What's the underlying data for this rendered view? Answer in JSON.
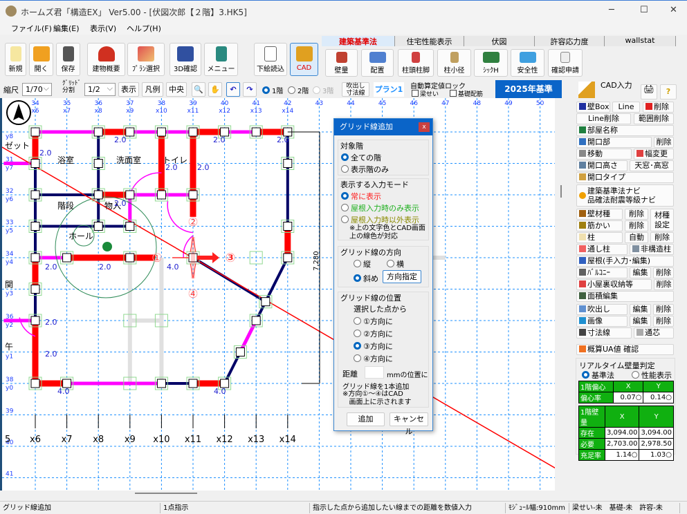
{
  "window": {
    "title": "ホームズ君「構造EX」 Ver5.00 - [伏図次郎【２階】3.HK5]",
    "minimize": "─",
    "maximize": "☐",
    "close": "✕"
  },
  "menu": [
    "ファイル(F)",
    "編集(E)",
    "表示(V)",
    "ヘルプ(H)"
  ],
  "toolbar": [
    {
      "label": "新規",
      "icon": "new-file-star-icon"
    },
    {
      "label": "開く",
      "icon": "open-folder-icon"
    },
    {
      "label": "保存",
      "icon": "save-floppy-icon"
    },
    {
      "label": "建物概要",
      "icon": "house-icon"
    },
    {
      "label": "ﾌﾟﾗﾝ選択",
      "icon": "plan-select-icon"
    },
    {
      "label": "3D確認",
      "icon": "3d-house-icon"
    },
    {
      "label": "メニュー",
      "icon": "exit-door-icon"
    },
    {
      "label": "下絵読込",
      "icon": "jpg-import-icon"
    },
    {
      "label": "CAD",
      "icon": "cad-triangle-icon",
      "active": true
    }
  ],
  "tabs": [
    {
      "label": "建築基準法",
      "active": true
    },
    {
      "label": "住宅性能表示"
    },
    {
      "label": "伏図"
    },
    {
      "label": "許容応力度"
    },
    {
      "label": "wallstat"
    }
  ],
  "tab_buttons": [
    "壁量",
    "配置",
    "柱頭柱脚",
    "柱小径",
    "ｼｯｸH",
    "安全性",
    "確認申請"
  ],
  "toolbar2": {
    "scale_label": "縮尺",
    "scale_value": "1/70",
    "grid_label_1": "ｸﾞﾘｯﾄﾞ",
    "grid_label_2": "分割",
    "grid_value": "1/2",
    "show": "表示",
    "legend": "凡例",
    "center": "中央",
    "floors": [
      {
        "label": "1階",
        "selected": true
      },
      {
        "label": "2階"
      },
      {
        "label": "3階",
        "disabled": true
      }
    ],
    "balloon_dim_1": "吹出し",
    "balloon_dim_2": "寸法線",
    "plan": "プラン1",
    "auto_lock": "自動算定値ロック",
    "beam": "梁せい",
    "foundation": "基礎配筋",
    "standard": "2025年基準"
  },
  "right_panel": {
    "cad_input": "CAD入力",
    "help": "?",
    "wall_box": "壁Box",
    "line": "Line",
    "delete": "削除",
    "line_delete": "Line削除",
    "range_delete": "範囲削除",
    "room_name": "部屋名称",
    "opening": "開口部",
    "move": "移動",
    "width_change": "幅変更",
    "opening_height": "開口高さ",
    "skylight": "天窓･高窓",
    "opening_type": "開口タイプ",
    "navi_1": "建築基準法ナビ",
    "navi_2": "品確法耐震等級ナビ",
    "wall_material": "壁材種",
    "brace": "筋かい",
    "material_setting_1": "材種",
    "material_setting_2": "設定",
    "column": "柱",
    "auto": "自動",
    "through_column": "通し柱",
    "nonstructural_column": "非構造柱",
    "roof": "屋根(手入力･編集)",
    "balcony": "ﾊﾞﾙｺﾆｰ",
    "edit": "編集",
    "attic": "小屋裏収納等",
    "area_edit": "面積編集",
    "balloon": "吹出し",
    "image": "画像",
    "dimension": "寸法線",
    "center_line": "通芯",
    "ua": "概算UA値 確認",
    "realtime": {
      "title": "リアルタイム壁量判定",
      "mode_standard": "基準法",
      "mode_performance": "性能表示",
      "selected": "基準法",
      "ecc_header": "1階偏心",
      "x": "X",
      "y": "Y",
      "ecc_label": "偏心率",
      "ecc_x": "0.07○",
      "ecc_y": "0.14○",
      "wall_header": "1階壁量",
      "rows": [
        {
          "label": "存在",
          "x": "3,094.00",
          "y": "3,094.00"
        },
        {
          "label": "必要",
          "x": "2,703.00",
          "y": "2,978.50"
        },
        {
          "label": "充足率",
          "x": "1.14○",
          "y": "1.03○"
        }
      ]
    }
  },
  "dialog": {
    "title": "グリッド線追加",
    "close": "x",
    "target_floor": {
      "title": "対象階",
      "options": [
        "全ての階",
        "表示階のみ"
      ],
      "selected": "全ての階"
    },
    "input_mode": {
      "title": "表示する入力モード",
      "options": [
        "常に表示",
        "屋根入力時のみ表示",
        "屋根入力時以外表示"
      ],
      "colors": [
        "#ff2020",
        "#20b020",
        "#8a8a00"
      ],
      "selected": "常に表示",
      "note_1": "※上の文字色とCAD画面",
      "note_2": "上の線色が対応"
    },
    "direction": {
      "title": "グリッド線の方向",
      "options": [
        "縦",
        "横",
        "斜め"
      ],
      "selected": "斜め",
      "specify": "方向指定"
    },
    "position": {
      "title": "グリッド線の位置",
      "from": "選択した点から",
      "options": [
        "①方向に",
        "②方向に",
        "③方向に",
        "④方向に"
      ],
      "selected": "③方向に",
      "distance_label": "距離",
      "distance_value": "",
      "distance_unit": "mmの位置に",
      "add_one": "グリッド線を1本追加",
      "note_1": "※方向①～④はCAD",
      "note_2": "画面上に示されます"
    },
    "add": "追加",
    "cancel": "キャンセル"
  },
  "canvas": {
    "col_numbers": [
      "34",
      "35",
      "36",
      "37",
      "38",
      "39",
      "40",
      "41",
      "42",
      "43",
      "44",
      "45",
      "46",
      "47",
      "48",
      "49",
      "50"
    ],
    "col_labels": [
      "x6",
      "x7",
      "x8",
      "x9",
      "x10",
      "x11",
      "x12",
      "x13",
      "x14"
    ],
    "row_labels": [
      [
        "",
        "y8"
      ],
      [
        "31",
        "y7"
      ],
      [
        "32",
        "y6"
      ],
      [
        "33",
        "y5"
      ],
      [
        "34",
        "y4"
      ],
      [
        "",
        "y3"
      ],
      [
        "36",
        "y2"
      ],
      [
        "",
        "y1"
      ],
      [
        "38",
        "y0"
      ],
      [
        "39",
        ""
      ],
      [
        "40",
        ""
      ],
      [
        "41",
        ""
      ]
    ],
    "bottom_labels": [
      "5",
      "x6",
      "x7",
      "x8",
      "x9",
      "x10",
      "x11",
      "x12",
      "x13",
      "x14"
    ],
    "rooms": [
      "浴室",
      "洗面室",
      "トイレ",
      "階段",
      "物入",
      "ホール",
      "ゼット",
      "関",
      "午"
    ],
    "wall_values": [
      "2.0",
      "2.0",
      "2.0",
      "2.0",
      "2.0",
      "2.0",
      "2.0",
      "2.0",
      "2.0",
      "4.0",
      "2.0",
      "2.0",
      "4.0",
      "4.0"
    ],
    "dimension": "7,280",
    "markers": [
      "①",
      "②",
      "③",
      "④"
    ],
    "colors": {
      "bearing_wall": "#ff0000",
      "partition": "#ff00ff",
      "frame": "#000066",
      "grid": "#1e90ff",
      "guide_line": "#ff0000",
      "circle": "#2e8b57"
    }
  },
  "status": {
    "mode": "グリッド線追加",
    "step": "1点指示",
    "hint": "指示した点から追加したい線までの距離を数値入力",
    "module": "ﾓｼﾞｭｰﾙ幅:910mm",
    "flags": "梁せい-未　基礎-未　許容-未"
  }
}
